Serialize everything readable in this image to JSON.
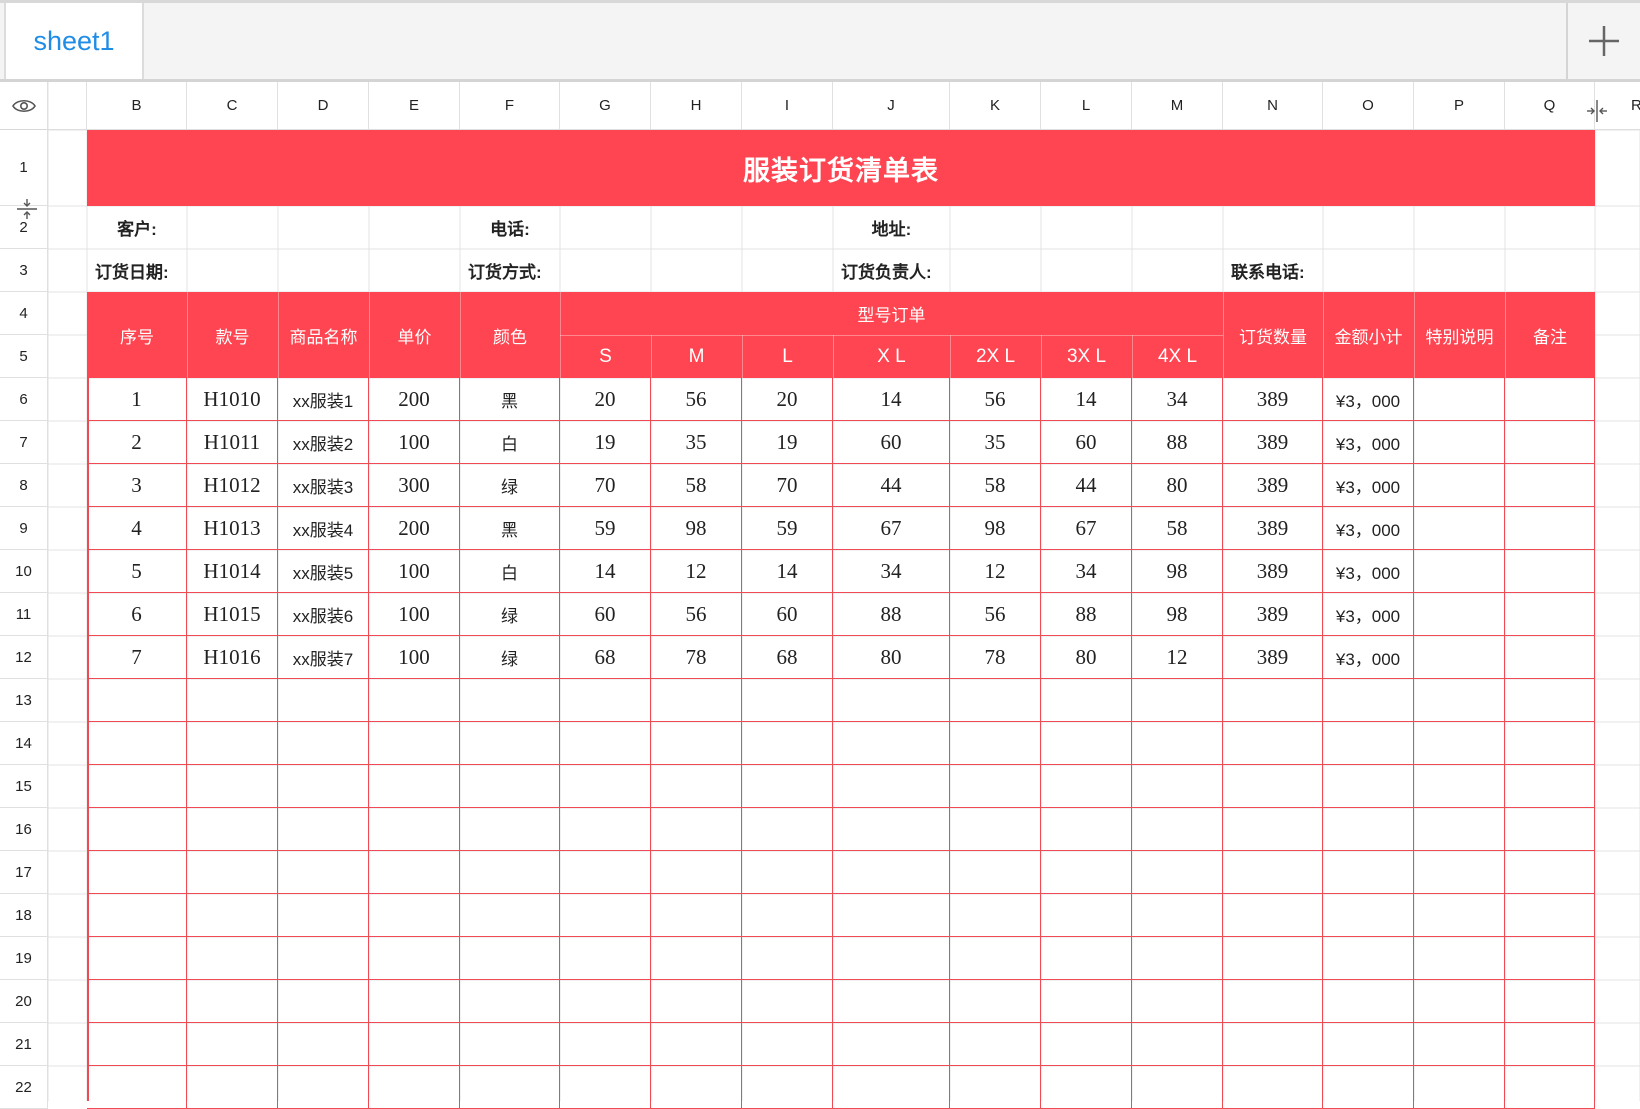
{
  "tabs": {
    "sheet_name": "sheet1",
    "add_symbol": "+"
  },
  "columns": [
    "B",
    "C",
    "D",
    "E",
    "F",
    "G",
    "H",
    "I",
    "J",
    "K",
    "L",
    "M",
    "N",
    "O",
    "P",
    "Q",
    "R"
  ],
  "rows": [
    "1",
    "2",
    "3",
    "4",
    "5",
    "6",
    "7",
    "8",
    "9",
    "10",
    "11",
    "12",
    "13",
    "14",
    "15",
    "16",
    "17",
    "18",
    "19",
    "20",
    "21",
    "22"
  ],
  "sheet": {
    "title": "服装订货清单表",
    "info": {
      "customer": "客户:",
      "phone": "电话:",
      "address": "地址:",
      "order_date": "订货日期:",
      "order_method": "订货方式:",
      "order_owner": "订货负责人:",
      "contact_phone": "联系电话:"
    },
    "headers": {
      "seq": "序号",
      "style_no": "款号",
      "product": "商品名称",
      "unit_price": "单价",
      "color": "颜色",
      "size_group": "型号订单",
      "sizes": [
        "S",
        "M",
        "L",
        "X L",
        "2X L",
        "3X L",
        "4X L"
      ],
      "qty": "订货数量",
      "subtotal": "金额小计",
      "special": "特别说明",
      "remark": "备注"
    },
    "items": [
      [
        "1",
        "H1010",
        "xx服装1",
        "200",
        "黑",
        "20",
        "56",
        "20",
        "14",
        "56",
        "14",
        "34",
        "389",
        "¥3，000"
      ],
      [
        "2",
        "H1011",
        "xx服装2",
        "100",
        "白",
        "19",
        "35",
        "19",
        "60",
        "35",
        "60",
        "88",
        "389",
        "¥3，000"
      ],
      [
        "3",
        "H1012",
        "xx服装3",
        "300",
        "绿",
        "70",
        "58",
        "70",
        "44",
        "58",
        "44",
        "80",
        "389",
        "¥3，000"
      ],
      [
        "4",
        "H1013",
        "xx服装4",
        "200",
        "黑",
        "59",
        "98",
        "59",
        "67",
        "98",
        "67",
        "58",
        "389",
        "¥3，000"
      ],
      [
        "5",
        "H1014",
        "xx服装5",
        "100",
        "白",
        "14",
        "12",
        "14",
        "34",
        "12",
        "34",
        "98",
        "389",
        "¥3，000"
      ],
      [
        "6",
        "H1015",
        "xx服装6",
        "100",
        "绿",
        "60",
        "56",
        "60",
        "88",
        "56",
        "88",
        "98",
        "389",
        "¥3，000"
      ],
      [
        "7",
        "H1016",
        "xx服装7",
        "100",
        "绿",
        "68",
        "78",
        "68",
        "80",
        "78",
        "80",
        "12",
        "389",
        "¥3，000"
      ]
    ]
  },
  "colors": {
    "accent": "#fe4551",
    "grid": "#f04b55",
    "tab_text": "#1f8de6"
  },
  "icons": {
    "view": "eye-icon",
    "add": "plus-icon",
    "freeze_col": "freeze-column-icon",
    "freeze_row": "freeze-row-icon"
  }
}
